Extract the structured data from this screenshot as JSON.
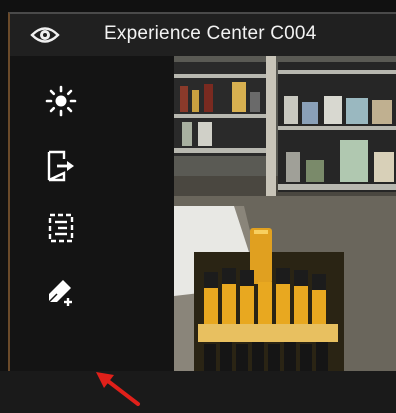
{
  "window": {
    "title": "Experience Center C004"
  },
  "icons": {
    "view": "eye-icon",
    "brightness": "brightness-icon",
    "export": "export-icon",
    "list": "list-icon",
    "add_tag": "add-tag-icon",
    "annotation": "red-arrow-icon"
  },
  "colors": {
    "title_bar": "#202020",
    "sidebar": "#141414",
    "accent_border": "#6a4a2a",
    "annotation_arrow": "#e0201a",
    "icon": "#ffffff"
  }
}
